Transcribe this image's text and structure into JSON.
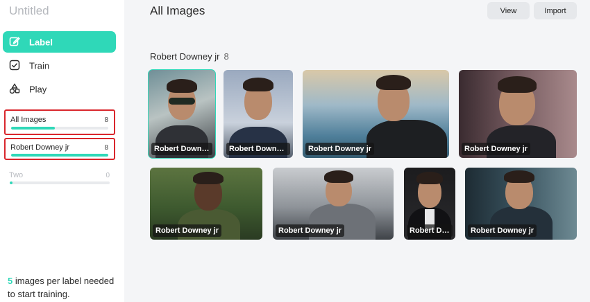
{
  "app": {
    "title": "Untitled"
  },
  "nav": [
    {
      "id": "label",
      "label": "Label",
      "icon": "edit-icon",
      "active": true
    },
    {
      "id": "train",
      "label": "Train",
      "icon": "checkbox-icon",
      "active": false
    },
    {
      "id": "play",
      "label": "Play",
      "icon": "shapes-icon",
      "active": false
    }
  ],
  "labels": [
    {
      "name": "All Images",
      "count": "8",
      "progress": 0.45
    },
    {
      "name": "Robert Downey jr",
      "count": "8",
      "progress": 1.0
    },
    {
      "name": "Two",
      "count": "0",
      "progress": 0.02
    }
  ],
  "hint": {
    "number": "5",
    "text": " images per label needed to start training."
  },
  "header": {
    "title": "All Images",
    "view_label": "View",
    "import_label": "Import"
  },
  "group": {
    "name": "Robert Downey jr",
    "count": "8"
  },
  "images": [
    {
      "caption": "Robert Downey jr",
      "selected": true
    },
    {
      "caption": "Robert Downey jr",
      "selected": false
    },
    {
      "caption": "Robert Downey jr",
      "selected": false
    },
    {
      "caption": "Robert Downey jr",
      "selected": false
    },
    {
      "caption": "Robert Downey jr",
      "selected": false
    },
    {
      "caption": "Robert Downey jr",
      "selected": false
    },
    {
      "caption": "Robert Downey jr",
      "selected": false
    },
    {
      "caption": "Robert Downey jr",
      "selected": false
    }
  ],
  "colors": {
    "accent": "#2fd8b8",
    "highlight_border": "#d9262c"
  }
}
